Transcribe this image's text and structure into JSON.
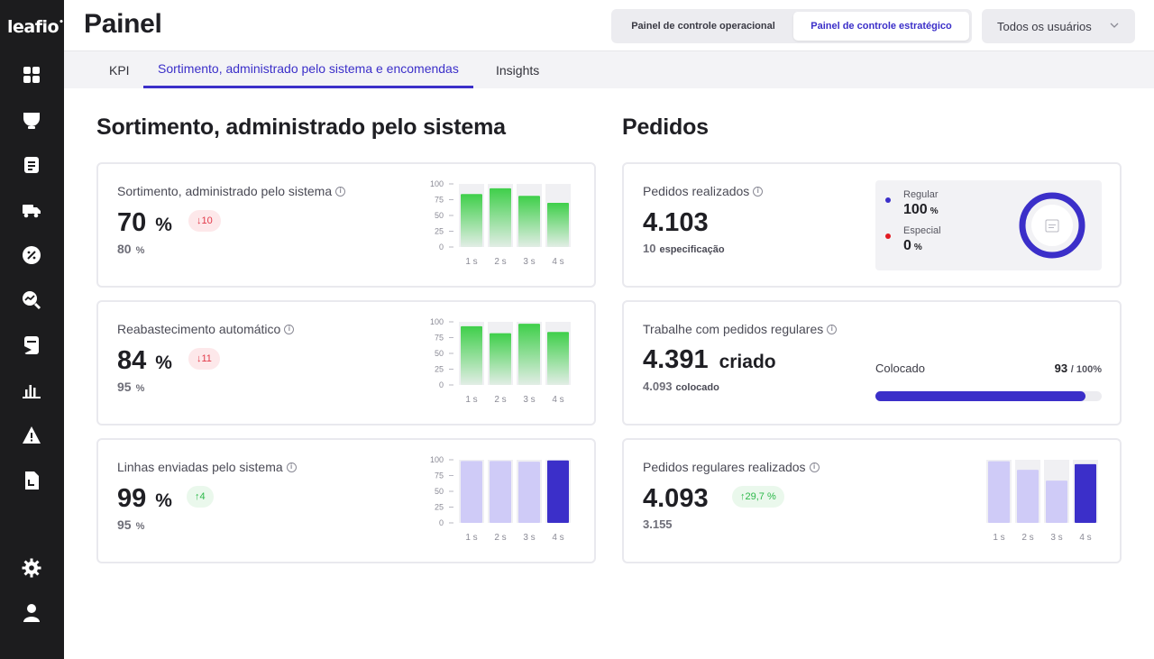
{
  "app": {
    "logo": "leafio",
    "logo_mark": "•"
  },
  "sidebar": {
    "items": [
      {
        "icon": "dashboard-icon"
      },
      {
        "icon": "lamp-icon"
      },
      {
        "icon": "document-list-icon"
      },
      {
        "icon": "truck-icon"
      },
      {
        "icon": "discount-icon"
      },
      {
        "icon": "analytics-search-icon"
      },
      {
        "icon": "flag-icon"
      },
      {
        "icon": "bar-chart-icon"
      },
      {
        "icon": "warning-icon"
      },
      {
        "icon": "file-icon"
      }
    ],
    "bottom": [
      {
        "icon": "gear-icon"
      },
      {
        "icon": "user-icon"
      }
    ]
  },
  "header": {
    "title": "Painel",
    "segment": {
      "operational": "Painel de controle operacional",
      "strategic": "Painel de controle estratégico",
      "active": "strategic"
    },
    "users_dropdown": "Todos os usuários"
  },
  "tabs": [
    {
      "label": "KPI"
    },
    {
      "label": "Sortimento, administrado pelo sistema e encomendas",
      "active": true
    },
    {
      "label": "Insights"
    }
  ],
  "left_section": {
    "title": "Sortimento, administrado pelo sistema",
    "cards": [
      {
        "title": "Sortimento, administrado pelo sistema",
        "value": "70",
        "unit": "%",
        "sub": "80",
        "sub_unit": "%",
        "delta": "↓10",
        "delta_type": "down"
      },
      {
        "title": "Reabastecimento automático",
        "value": "84",
        "unit": "%",
        "sub": "95",
        "sub_unit": "%",
        "delta": "↓11",
        "delta_type": "down"
      },
      {
        "title": "Linhas enviadas pelo sistema",
        "value": "99",
        "unit": "%",
        "sub": "95",
        "sub_unit": "%",
        "delta": "↑4",
        "delta_type": "up"
      }
    ]
  },
  "right_section": {
    "title": "Pedidos",
    "orders_placed": {
      "title": "Pedidos realizados",
      "value": "4.103",
      "sub": "10",
      "sub_label": "especificação",
      "legend": [
        {
          "name": "Regular",
          "value": "100",
          "unit": "%",
          "color": "#3b2fc9"
        },
        {
          "name": "Especial",
          "value": "0",
          "unit": "%",
          "color": "#e21b23"
        }
      ],
      "donut_icon": "document-icon"
    },
    "regular_work": {
      "title": "Trabalhe com pedidos regulares",
      "value": "4.391",
      "value_word": "criado",
      "sub": "4.093",
      "sub_word": "colocado",
      "progress_label": "Colocado",
      "progress_value": "93",
      "progress_total": "/ 100%",
      "progress_fraction": 0.93
    },
    "regular_placed": {
      "title": "Pedidos regulares realizados",
      "value": "4.093",
      "sub": "3.155",
      "delta": "↑29,7 %",
      "delta_type": "up"
    }
  },
  "chart_data": [
    {
      "type": "bar",
      "categories": [
        "1 s",
        "2 s",
        "3 s",
        "4 s"
      ],
      "values": [
        84,
        93,
        81,
        70
      ],
      "yticks": [
        "100",
        "75",
        "50",
        "25",
        "0"
      ],
      "ylim": [
        0,
        100
      ],
      "color": "#3fcf4a"
    },
    {
      "type": "bar",
      "categories": [
        "1 s",
        "2 s",
        "3 s",
        "4 s"
      ],
      "values": [
        93,
        82,
        97,
        84
      ],
      "yticks": [
        "100",
        "75",
        "50",
        "25",
        "0"
      ],
      "ylim": [
        0,
        100
      ],
      "color": "#3fcf4a"
    },
    {
      "type": "bar",
      "categories": [
        "1 s",
        "2 s",
        "3 s",
        "4 s"
      ],
      "values": [
        98,
        98,
        97,
        99
      ],
      "yticks": [
        "100",
        "75",
        "50",
        "25",
        "0"
      ],
      "ylim": [
        0,
        100
      ],
      "color": "#cfcbf7",
      "highlight_color": "#3b2fc9",
      "highlight_index": 3
    },
    {
      "type": "bar",
      "categories": [
        "1 s",
        "2 s",
        "3 s",
        "4 s"
      ],
      "values": [
        4300,
        3700,
        2950,
        4093
      ],
      "ylim": [
        0,
        4400
      ],
      "color": "#cfcbf7",
      "highlight_color": "#3b2fc9",
      "highlight_index": 3
    }
  ]
}
